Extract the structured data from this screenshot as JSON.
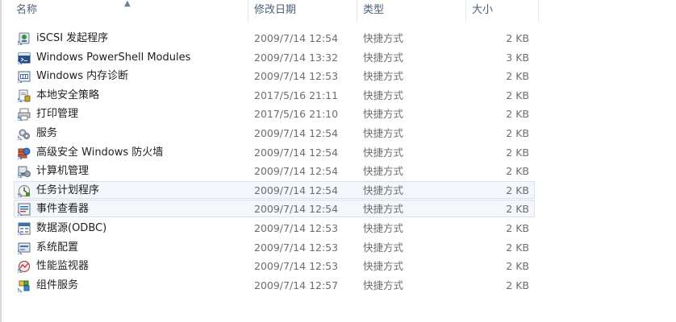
{
  "columns": {
    "name": "名称",
    "date": "修改日期",
    "type": "类型",
    "size": "大小"
  },
  "files": [
    {
      "name": "iSCSI 发起程序",
      "date": "2009/7/14 12:54",
      "type": "快捷方式",
      "size": "2 KB",
      "icon": "iscsi-initiator-icon"
    },
    {
      "name": "Windows PowerShell Modules",
      "date": "2009/7/14 13:32",
      "type": "快捷方式",
      "size": "3 KB",
      "icon": "powershell-modules-icon"
    },
    {
      "name": "Windows 内存诊断",
      "date": "2009/7/14 12:53",
      "type": "快捷方式",
      "size": "2 KB",
      "icon": "memory-diagnostic-icon"
    },
    {
      "name": "本地安全策略",
      "date": "2017/5/16 21:11",
      "type": "快捷方式",
      "size": "2 KB",
      "icon": "local-security-policy-icon"
    },
    {
      "name": "打印管理",
      "date": "2017/5/16 21:10",
      "type": "快捷方式",
      "size": "2 KB",
      "icon": "print-management-icon"
    },
    {
      "name": "服务",
      "date": "2009/7/14 12:54",
      "type": "快捷方式",
      "size": "2 KB",
      "icon": "services-icon"
    },
    {
      "name": "高级安全 Windows 防火墙",
      "date": "2009/7/14 12:54",
      "type": "快捷方式",
      "size": "2 KB",
      "icon": "firewall-icon"
    },
    {
      "name": "计算机管理",
      "date": "2009/7/14 12:54",
      "type": "快捷方式",
      "size": "2 KB",
      "icon": "computer-management-icon"
    },
    {
      "name": "任务计划程序",
      "date": "2009/7/14 12:54",
      "type": "快捷方式",
      "size": "2 KB",
      "icon": "task-scheduler-icon"
    },
    {
      "name": "事件查看器",
      "date": "2009/7/14 12:54",
      "type": "快捷方式",
      "size": "2 KB",
      "icon": "event-viewer-icon"
    },
    {
      "name": "数据源(ODBC)",
      "date": "2009/7/14 12:53",
      "type": "快捷方式",
      "size": "2 KB",
      "icon": "odbc-data-source-icon"
    },
    {
      "name": "系统配置",
      "date": "2009/7/14 12:53",
      "type": "快捷方式",
      "size": "2 KB",
      "icon": "system-configuration-icon"
    },
    {
      "name": "性能监视器",
      "date": "2009/7/14 12:53",
      "type": "快捷方式",
      "size": "2 KB",
      "icon": "performance-monitor-icon"
    },
    {
      "name": "组件服务",
      "date": "2009/7/14 12:57",
      "type": "快捷方式",
      "size": "2 KB",
      "icon": "component-services-icon"
    }
  ],
  "highlighted_rows": [
    8,
    9
  ]
}
